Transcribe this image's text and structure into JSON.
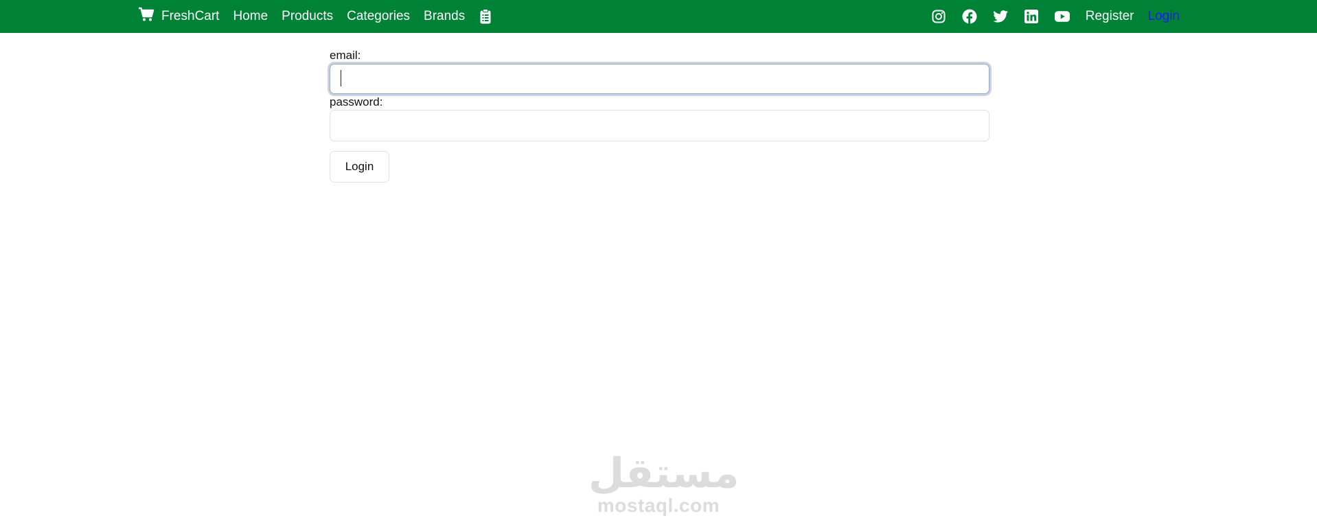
{
  "navbar": {
    "brand": {
      "name": "FreshCart",
      "icon": "cart-icon"
    },
    "links": [
      {
        "label": "Home"
      },
      {
        "label": "Products"
      },
      {
        "label": "Categories"
      },
      {
        "label": "Brands"
      }
    ],
    "orders_icon": "clipboard-icon",
    "social_icons": [
      "instagram-icon",
      "facebook-icon",
      "twitter-icon",
      "linkedin-icon",
      "youtube-icon"
    ],
    "register_label": "Register",
    "login_label": "Login",
    "colors": {
      "background": "#008236",
      "active_link": "#1a1aff"
    }
  },
  "form": {
    "email_label": "email:",
    "email_value": "",
    "password_label": "password:",
    "password_value": "",
    "submit_label": "Login"
  },
  "watermark": {
    "arabic": "مستقل",
    "latin": "mostaql.com"
  }
}
